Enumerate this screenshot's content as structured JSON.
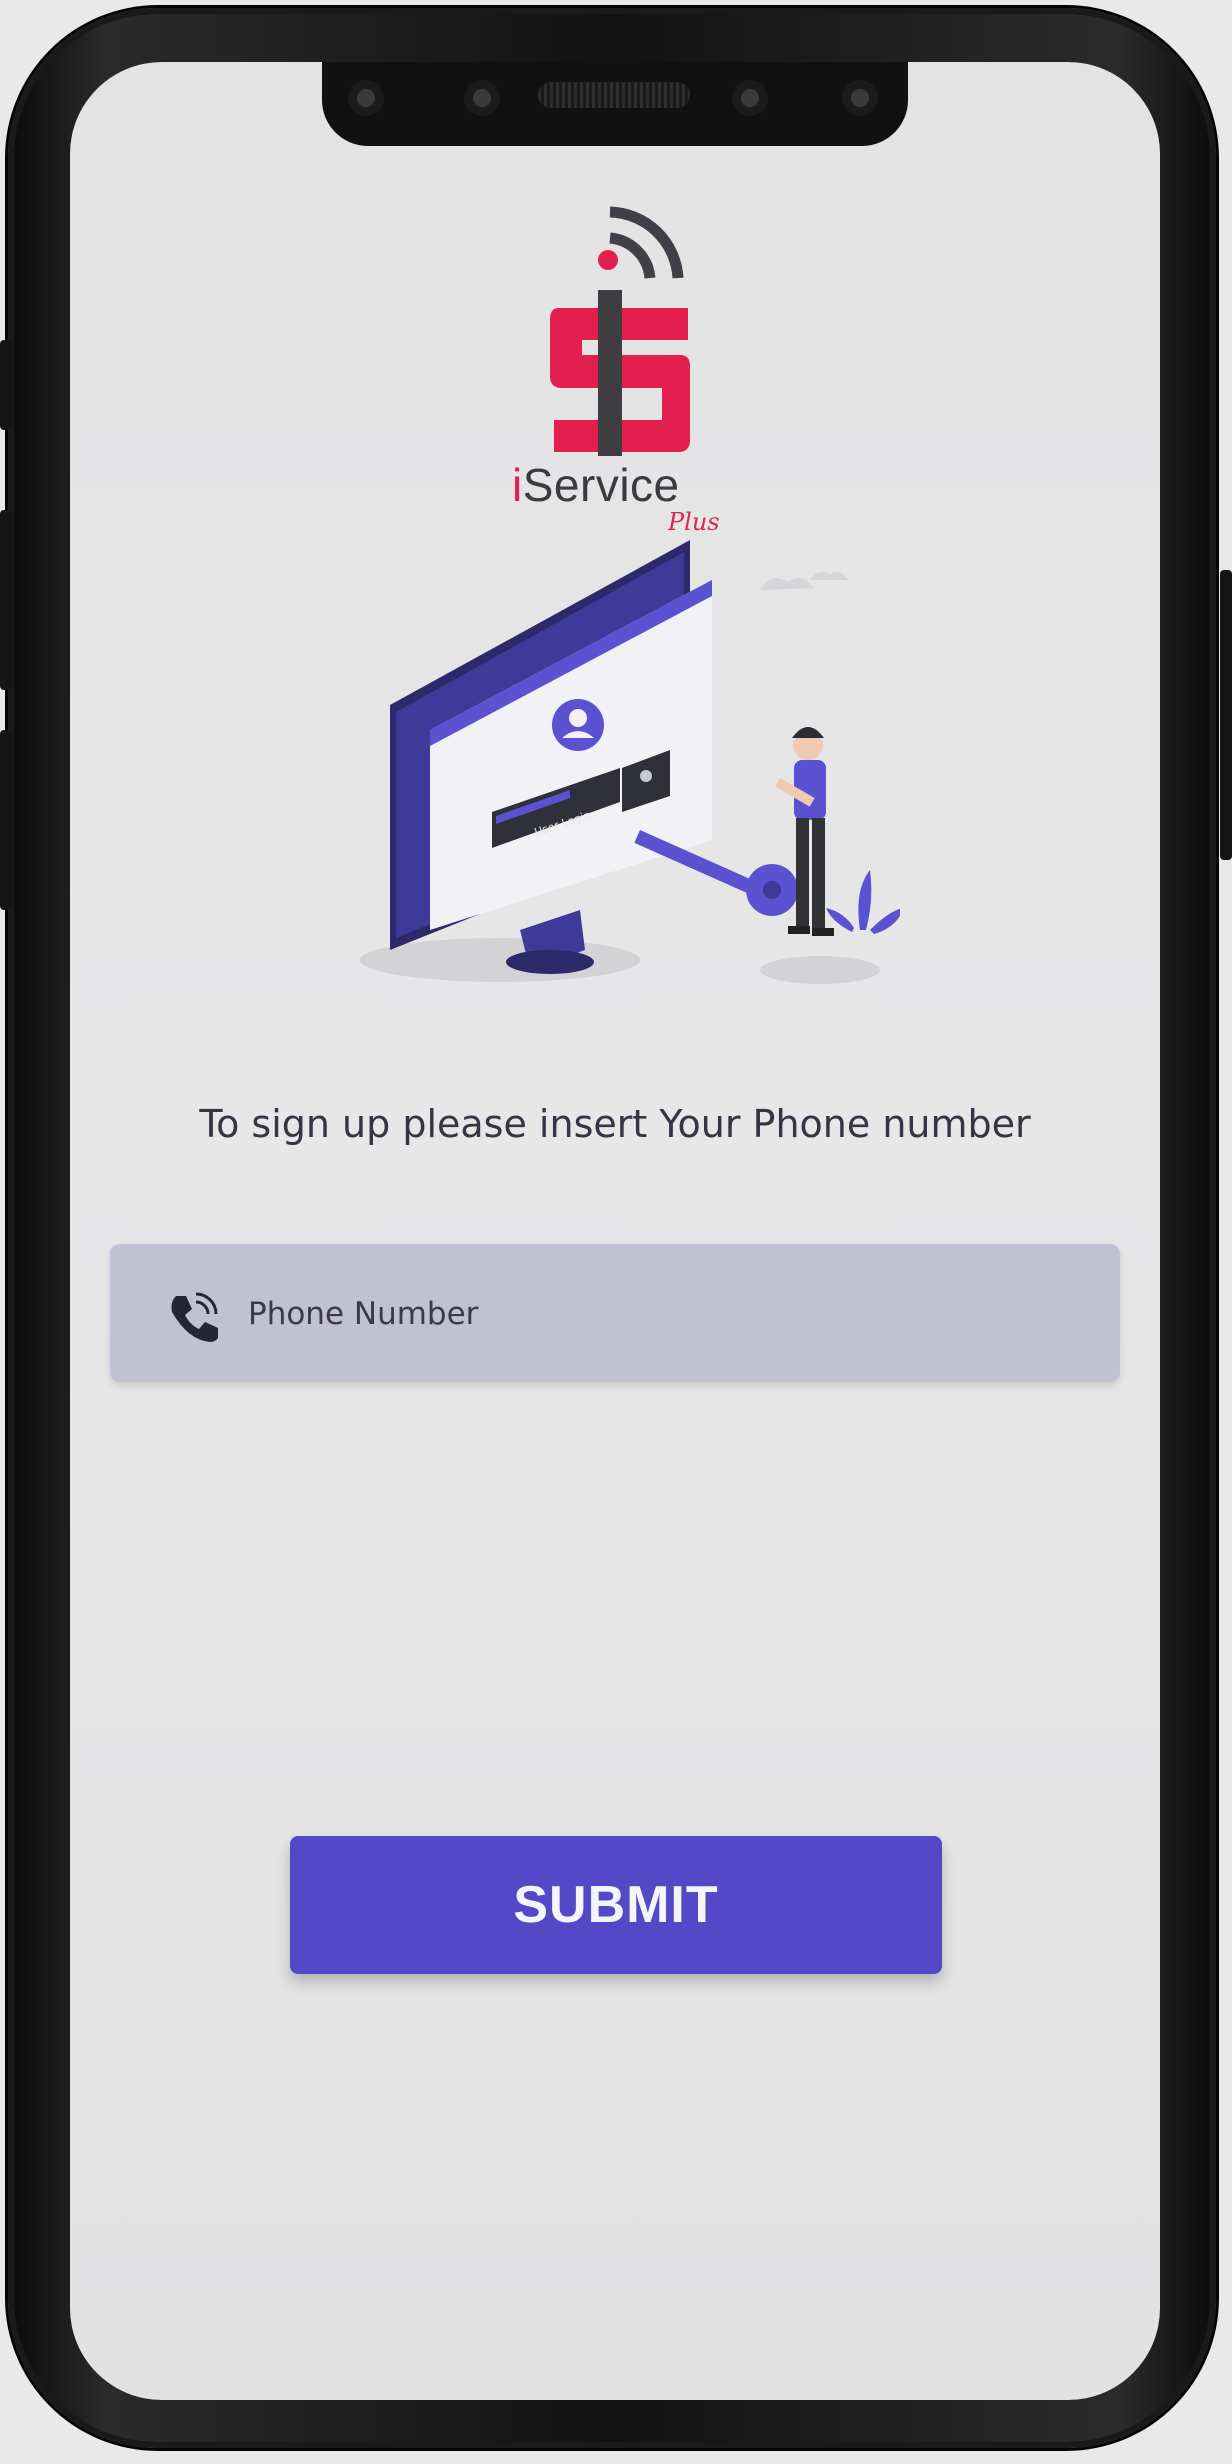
{
  "app": {
    "brand_prefix": "i",
    "brand_name": "Service",
    "brand_suffix": "Plus"
  },
  "illustration": {
    "screen_button_label": "User Login"
  },
  "signup": {
    "instruction": "To sign up please insert Your Phone number",
    "phone_placeholder": "Phone Number",
    "phone_value": "",
    "submit_label": "SUBMIT"
  },
  "colors": {
    "accent": "#5348c5",
    "brand_red": "#e21f4e",
    "field_bg": "#c2c0d4",
    "screen_bg": "#e5e5e6"
  },
  "icons": {
    "phone_field_icon": "phone-ringing-icon",
    "logo_icon": "wifi-signal-icon"
  }
}
